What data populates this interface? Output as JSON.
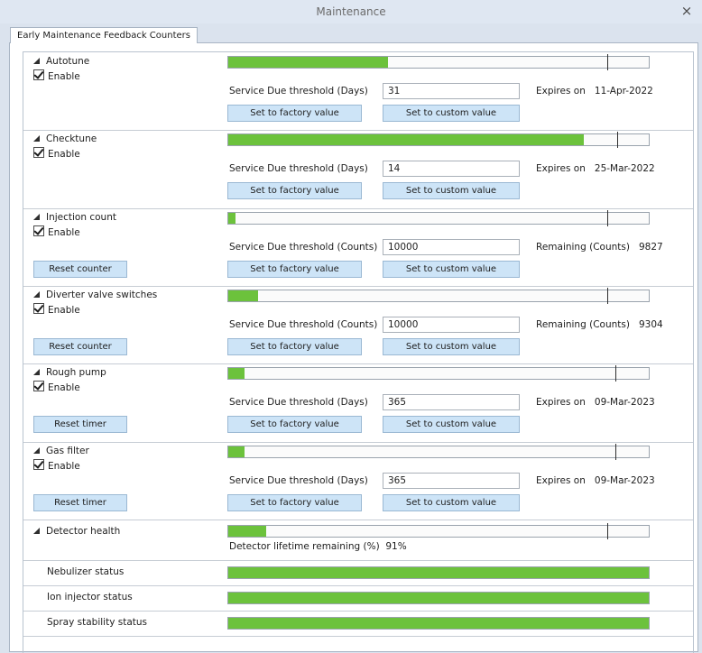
{
  "window": {
    "title": "Maintenance",
    "close_glyph": "×"
  },
  "tabs": [
    {
      "label": "Early Maintenance Feedback Counters"
    }
  ],
  "labels": {
    "enable": "Enable",
    "set_factory": "Set to factory value",
    "set_custom": "Set to custom value",
    "detector_lifetime": "Detector lifetime remaining (%)"
  },
  "sections": [
    {
      "name": "Autotune",
      "enabled": true,
      "progress": 0.38,
      "marker": 0.902,
      "threshold_label": "Service Due threshold (Days)",
      "threshold_value": "31",
      "info_label": "Expires on",
      "info_value": "11-Apr-2022",
      "reset_label": ""
    },
    {
      "name": "Checktune",
      "enabled": true,
      "progress": 0.846,
      "marker": 0.924,
      "threshold_label": "Service Due threshold (Days)",
      "threshold_value": "14",
      "info_label": "Expires on",
      "info_value": "25-Mar-2022",
      "reset_label": ""
    },
    {
      "name": "Injection count",
      "enabled": true,
      "progress": 0.017,
      "marker": 0.902,
      "threshold_label": "Service Due threshold (Counts)",
      "threshold_value": "10000",
      "info_label": "Remaining (Counts)",
      "info_value": "9827",
      "reset_label": "Reset counter"
    },
    {
      "name": "Diverter valve switches",
      "enabled": true,
      "progress": 0.07,
      "marker": 0.902,
      "threshold_label": "Service Due threshold (Counts)",
      "threshold_value": "10000",
      "info_label": "Remaining (Counts)",
      "info_value": "9304",
      "reset_label": "Reset counter"
    },
    {
      "name": "Rough pump",
      "enabled": true,
      "progress": 0.038,
      "marker": 0.921,
      "threshold_label": "Service Due threshold (Days)",
      "threshold_value": "365",
      "info_label": "Expires on",
      "info_value": "09-Mar-2023",
      "reset_label": "Reset timer"
    },
    {
      "name": "Gas filter",
      "enabled": true,
      "progress": 0.038,
      "marker": 0.921,
      "threshold_label": "Service Due threshold (Days)",
      "threshold_value": "365",
      "info_label": "Expires on",
      "info_value": "09-Mar-2023",
      "reset_label": "Reset timer"
    }
  ],
  "detector": {
    "name": "Detector health",
    "progress": 0.09,
    "marker": 0.902,
    "lifetime_value": "91%"
  },
  "statuses": [
    {
      "name": "Nebulizer status",
      "progress": 1.0
    },
    {
      "name": "Ion injector status",
      "progress": 1.0
    },
    {
      "name": "Spray stability status",
      "progress": 1.0
    }
  ],
  "colors": {
    "progress_fill": "#6cc23c",
    "button_bg": "#cde4f7"
  }
}
